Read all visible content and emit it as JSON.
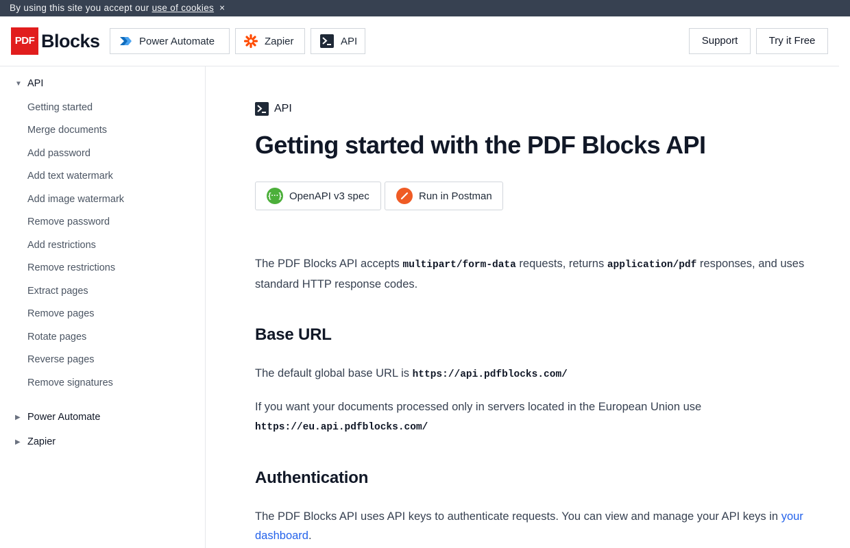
{
  "cookie": {
    "text": "By using this site you accept our",
    "link": "use of cookies",
    "close": "×"
  },
  "header": {
    "logo_pdf": "PDF",
    "logo_blocks": "Blocks",
    "nav": {
      "power_automate": "Power Automate",
      "zapier": "Zapier",
      "api": "API"
    },
    "support": "Support",
    "try_free": "Try it Free"
  },
  "sidebar": {
    "api": {
      "label": "API",
      "toggle": "▼",
      "items": [
        "Getting started",
        "Merge documents",
        "Add password",
        "Add text watermark",
        "Add image watermark",
        "Remove password",
        "Add restrictions",
        "Remove restrictions",
        "Extract pages",
        "Remove pages",
        "Rotate pages",
        "Reverse pages",
        "Remove signatures"
      ]
    },
    "power_automate": {
      "label": "Power Automate",
      "toggle": "▶"
    },
    "zapier": {
      "label": "Zapier",
      "toggle": "▶"
    }
  },
  "main": {
    "breadcrumb": "API",
    "title": "Getting started with the PDF Blocks API",
    "openapi_button": "OpenAPI v3 spec",
    "postman_button": "Run in Postman",
    "intro": {
      "t1": "The PDF Blocks API accepts ",
      "c1": "multipart/form-data",
      "t2": " requests, returns ",
      "c2": "application/pdf",
      "t3": " responses, and uses standard HTTP response codes."
    },
    "base_url": {
      "heading": "Base URL",
      "p1_text": "The default global base URL is ",
      "p1_code": "https://api.pdfblocks.com/",
      "p2_text": "If you want your documents processed only in servers located in the European Union use ",
      "p2_code": "https://eu.api.pdfblocks.com/"
    },
    "auth": {
      "heading": "Authentication",
      "text": "The PDF Blocks API uses API keys to authenticate requests. You can view and manage your API keys in ",
      "link": "your dashboard",
      "end": "."
    }
  },
  "colors": {
    "brand_red": "#e11d1d",
    "link_blue": "#2563eb",
    "cookie_bar": "#374151",
    "openapi_green": "#4caf3a",
    "postman_orange": "#ef5b25",
    "zapier_orange": "#ff4a00"
  }
}
